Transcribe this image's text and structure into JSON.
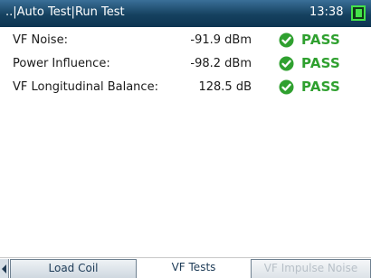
{
  "header": {
    "title": "..|Auto Test|Run Test",
    "time": "13:38",
    "battery_color": "#44e24a"
  },
  "results": [
    {
      "label": "VF Noise:",
      "value": "-91.9 dBm",
      "status": "PASS",
      "icon": "check-circle-icon"
    },
    {
      "label": "Power Influence:",
      "value": "-98.2 dBm",
      "status": "PASS",
      "icon": "check-circle-icon"
    },
    {
      "label": "VF Longitudinal Balance:",
      "value": "128.5 dB",
      "status": "PASS",
      "icon": "check-circle-icon"
    }
  ],
  "colors": {
    "pass": "#2fa02f",
    "header_bg": "#15415f"
  },
  "tabs": [
    {
      "label": "Load Coil",
      "state": "inactive"
    },
    {
      "label": "VF Tests",
      "state": "active"
    },
    {
      "label": "VF Impulse Noise",
      "state": "disabled"
    }
  ]
}
